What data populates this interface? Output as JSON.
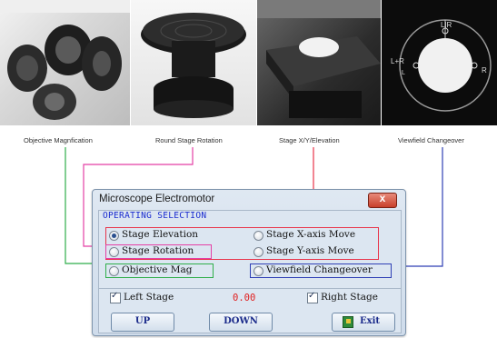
{
  "captions": {
    "c1": "Objective Magnfication",
    "c2": "Round Stage Rotation",
    "c3": "Stage X/Y/Elevation",
    "c4": "Viewfield Changeover"
  },
  "viewfield_photo_labels": {
    "top": "L|R",
    "left": "L+R",
    "left_small": "L",
    "right": "R"
  },
  "dialog": {
    "title": "Microscope Electromotor",
    "close_label": "x",
    "group_label": "OPERATING SELECTION",
    "options": {
      "stage_elevation": {
        "label": "Stage Elevation",
        "selected": true
      },
      "stage_x_move": {
        "label": "Stage X-axis Move",
        "selected": false
      },
      "stage_rotation": {
        "label": "Stage Rotation",
        "selected": false
      },
      "stage_y_move": {
        "label": "Stage Y-axis Move",
        "selected": false
      },
      "objective_mag": {
        "label": "Objective Mag",
        "selected": false
      },
      "viewfield_changeover": {
        "label": "Viewfield Changeover",
        "selected": false
      }
    },
    "left_stage": {
      "label": "Left Stage",
      "checked": true
    },
    "right_stage": {
      "label": "Right Stage",
      "checked": true
    },
    "value": "0.00",
    "buttons": {
      "up": "UP",
      "down": "DOWN",
      "exit": "Exit"
    }
  },
  "colors": {
    "callout_red": "#e8344a",
    "callout_magenta": "#e43fa5",
    "callout_green": "#2fae4a",
    "callout_blue": "#2e3fb5",
    "group_label": "#1a2ccf",
    "value": "#e02020"
  },
  "icons": {
    "close": "close-icon",
    "exit": "exit-door-icon",
    "radio": "radio-icon",
    "checkbox": "checkbox-icon"
  }
}
